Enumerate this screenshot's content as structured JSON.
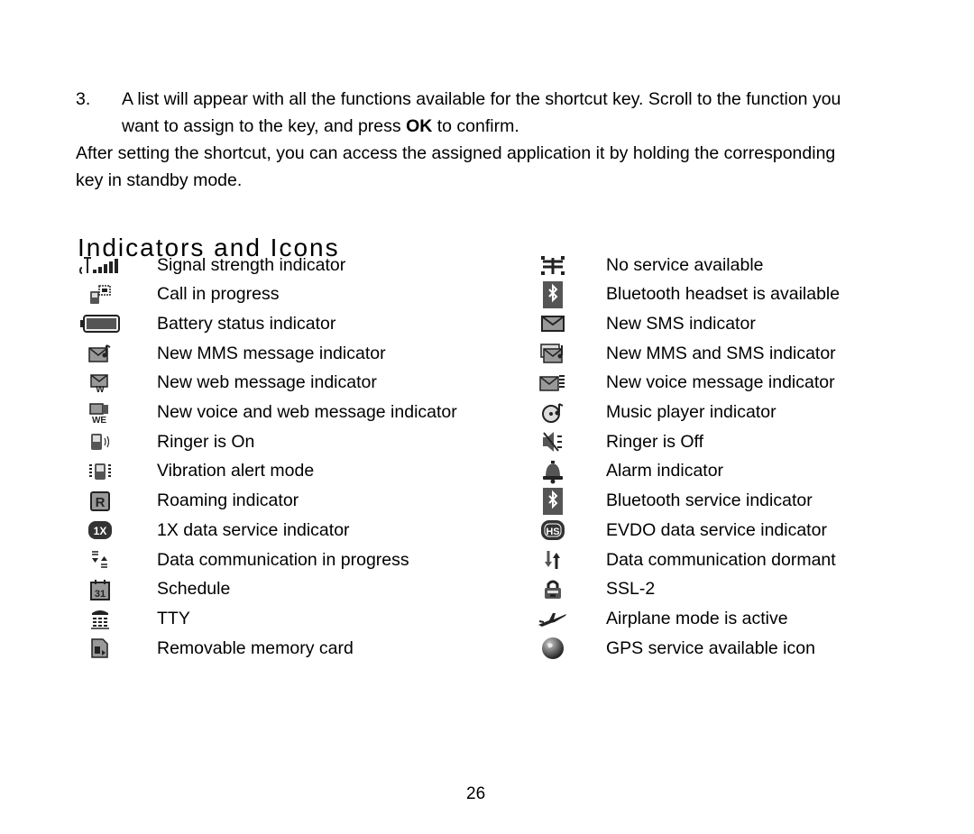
{
  "instructions": {
    "step_number": "3.",
    "step_text_before_bold": "A list will appear with all the functions available for the shortcut key. Scroll to the function you want to assign to the key, and press ",
    "step_bold": "OK",
    "step_text_after_bold": " to confirm.",
    "after_paragraph": "After setting the shortcut, you can access the assigned application it by holding the corresponding key in standby mode."
  },
  "section": {
    "title": "Indicators and Icons"
  },
  "left_column": [
    {
      "icon": "signal-strength-icon",
      "label": "Signal strength indicator"
    },
    {
      "icon": "call-in-progress-icon",
      "label": "Call in progress"
    },
    {
      "icon": "battery-icon",
      "label": "Battery status indicator"
    },
    {
      "icon": "mms-message-icon",
      "label": "New MMS message indicator"
    },
    {
      "icon": "web-message-icon",
      "label": "New web message indicator"
    },
    {
      "icon": "voice-web-message-icon",
      "label": "New voice and web message indicator"
    },
    {
      "icon": "ringer-on-icon",
      "label": "Ringer is On"
    },
    {
      "icon": "vibration-icon",
      "label": "Vibration alert mode"
    },
    {
      "icon": "roaming-icon",
      "label": "Roaming indicator"
    },
    {
      "icon": "1x-data-icon",
      "label": "1X data service indicator"
    },
    {
      "icon": "data-in-progress-icon",
      "label": "Data communication in progress"
    },
    {
      "icon": "schedule-icon",
      "label": "Schedule"
    },
    {
      "icon": "tty-icon",
      "label": "TTY"
    },
    {
      "icon": "memory-card-icon",
      "label": "Removable memory card"
    }
  ],
  "right_column": [
    {
      "icon": "no-service-icon",
      "label": "No service available"
    },
    {
      "icon": "bluetooth-headset-icon",
      "label": "Bluetooth headset is available"
    },
    {
      "icon": "sms-icon",
      "label": "New SMS indicator"
    },
    {
      "icon": "mms-sms-icon",
      "label": "New MMS and SMS indicator"
    },
    {
      "icon": "voice-message-icon",
      "label": "New voice message indicator"
    },
    {
      "icon": "music-player-icon",
      "label": "Music player indicator"
    },
    {
      "icon": "ringer-off-icon",
      "label": "Ringer is Off"
    },
    {
      "icon": "alarm-icon",
      "label": "Alarm indicator"
    },
    {
      "icon": "bluetooth-service-icon",
      "label": "Bluetooth service indicator"
    },
    {
      "icon": "evdo-data-icon",
      "label": "EVDO data service indicator",
      "badge": "HS"
    },
    {
      "icon": "data-dormant-icon",
      "label": "Data communication dormant"
    },
    {
      "icon": "ssl-lock-icon",
      "label": "SSL-2"
    },
    {
      "icon": "airplane-icon",
      "label": "Airplane mode is active"
    },
    {
      "icon": "gps-globe-icon",
      "label": "GPS service available icon"
    }
  ],
  "badges": {
    "roaming": "R",
    "one_x": "1X",
    "evdo": "HS",
    "schedule_day": "31"
  },
  "footer": {
    "page_number": "26"
  }
}
